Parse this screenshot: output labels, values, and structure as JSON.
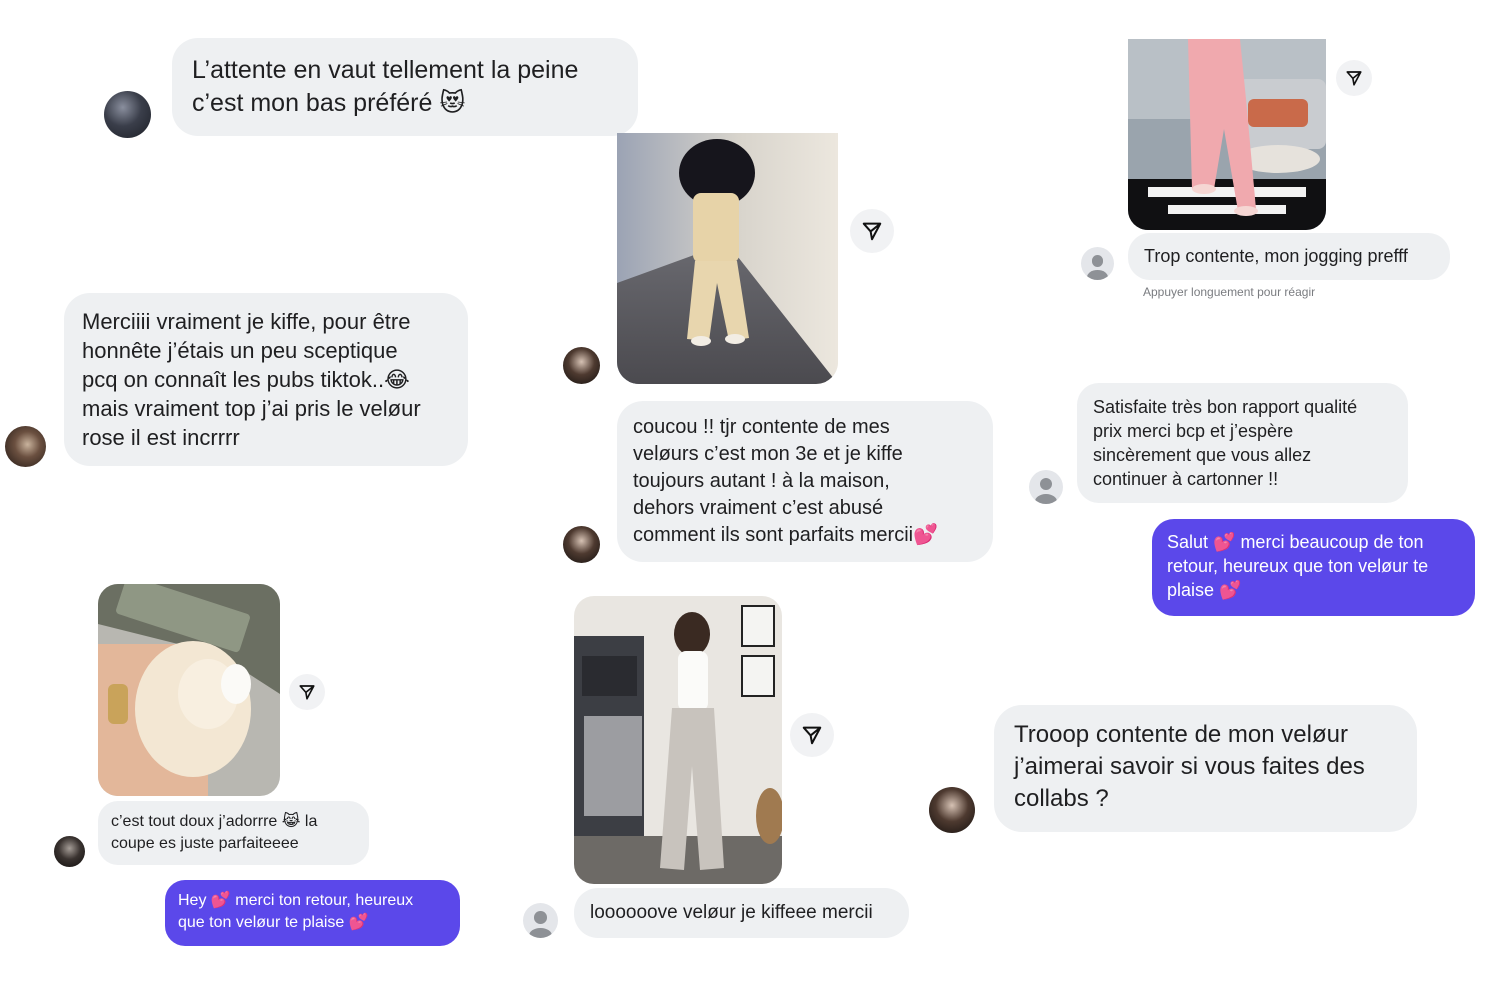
{
  "messages": {
    "m1": "L’attente en vaut tellement la peine\nc’est mon bas préféré 😻",
    "m2": "Merciiii vraiment je kiffe, pour être\nhonnête j’étais un peu sceptique\npcq on connaît les pubs tiktok..😂\nmais vraiment top j’ai pris le veløur\nrose il est incrrrr",
    "m3": "coucou !! tjr contente de mes\nveløurs c’est mon 3e et je kiffe\ntoujours autant ! à la maison,\ndehors vraiment c’est abusé\ncomment ils sont parfaits mercii💕",
    "m4": "Trop contente, mon jogging prefff",
    "m4_hint": "Appuyer longuement pour réagir",
    "m5": "Satisfaite très bon rapport qualité\nprix merci bcp et j’espère\nsincèrement que vous allez\ncontinuer à cartonner !!",
    "m5_reply": "Salut 💕 merci beaucoup de ton\nretour, heureux que ton veløur te\nplaise 💕",
    "m6": "c’est tout doux j’adorrre 😹 la\ncoupe es juste parfaiteeee",
    "m6_reply": "Hey 💕 merci ton retour, heureux\nque ton veløur te plaise 💕",
    "m7": "loooooove veløur je kiffeee mercii",
    "m8": "Trooop contente de mon veløur\nj’aimerai savoir si vous faites des\ncollabs ?"
  },
  "icons": {
    "share": "paper-plane-icon",
    "avatar_placeholder": "user-icon"
  },
  "colors": {
    "received_bubble": "#eef0f2",
    "sent_bubble": "#5b48ea",
    "sent_text": "#ffffff"
  }
}
